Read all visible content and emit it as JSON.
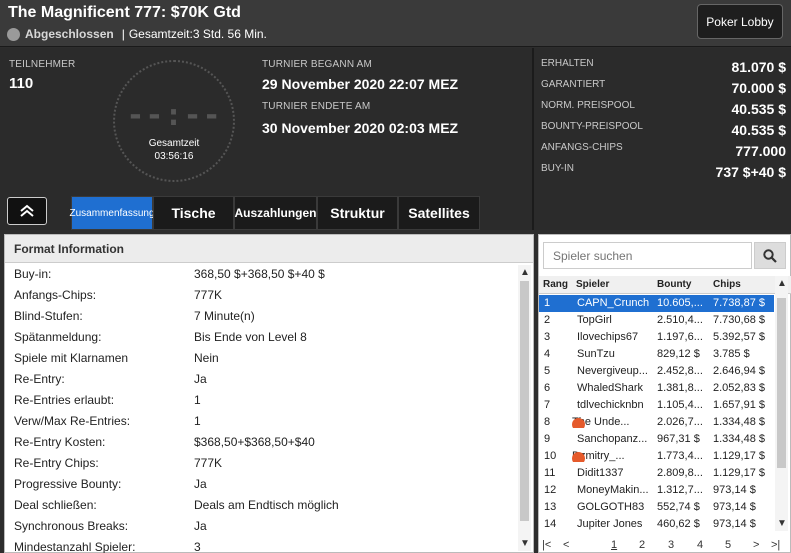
{
  "header": {
    "title": "The Magnificent 777: $70K Gtd",
    "status": "Abgeschlossen",
    "separator": "|",
    "total_time": "Gesamtzeit:3 Std.  56 Min.",
    "lobby_button": "Poker Lobby"
  },
  "info": {
    "participants_label": "TEILNEHMER",
    "participants_value": "110",
    "clock_digits": "--:--",
    "clock_label": "Gesamtzeit",
    "clock_time": "03:56:16",
    "begin_label": "TURNIER BEGANN AM",
    "begin_value": "29 November 2020  22:07 MEZ",
    "end_label": "TURNIER ENDETE AM",
    "end_value": "30 November 2020  02:03 MEZ"
  },
  "prize": [
    {
      "label": "ERHALTEN",
      "value": "81.070 $"
    },
    {
      "label": "GARANTIERT",
      "value": "70.000 $"
    },
    {
      "label": "NORM. PREISPOOL",
      "value": "40.535 $"
    },
    {
      "label": "BOUNTY-PREISPOOL",
      "value": "40.535 $"
    },
    {
      "label": "ANFANGS-CHIPS",
      "value": "777.000"
    },
    {
      "label": "BUY-IN",
      "value": "737 $+40 $"
    }
  ],
  "tabs": [
    {
      "label": "Zusammenfassung",
      "active": true
    },
    {
      "label": "Tische",
      "active": false
    },
    {
      "label": "Auszahlungen",
      "active": false
    },
    {
      "label": "Struktur",
      "active": false
    },
    {
      "label": "Satellites",
      "active": false
    }
  ],
  "format": {
    "title": "Format Information",
    "rows": [
      {
        "label": "Buy-in:",
        "value": "368,50 $+368,50 $+40 $"
      },
      {
        "label": "Anfangs-Chips:",
        "value": "777K"
      },
      {
        "label": "Blind-Stufen:",
        "value": "7 Minute(n)"
      },
      {
        "label": "Spätanmeldung:",
        "value": "Bis Ende von Level 8"
      },
      {
        "label": "Spiele mit Klarnamen",
        "value": "Nein"
      },
      {
        "label": "Re-Entry:",
        "value": "Ja"
      },
      {
        "label": "Re-Entries erlaubt:",
        "value": "1"
      },
      {
        "label": "Verw/Max Re-Entries:",
        "value": "1"
      },
      {
        "label": "Re-Entry Kosten:",
        "value": "$368,50+$368,50+$40"
      },
      {
        "label": "Re-Entry Chips:",
        "value": "777K"
      },
      {
        "label": "Progressive Bounty:",
        "value": "Ja"
      },
      {
        "label": "Deal schließen:",
        "value": "Deals am Endtisch möglich"
      },
      {
        "label": "Synchronous Breaks:",
        "value": "Ja"
      },
      {
        "label": "Mindestanzahl Spieler:",
        "value": "3"
      }
    ]
  },
  "players": {
    "search_placeholder": "Spieler suchen",
    "columns": [
      "Rang",
      "Spieler",
      "Bounty",
      "Chips"
    ],
    "rows": [
      {
        "rank": "1",
        "name": "CAPN_Crunch",
        "bounty": "10.605,...",
        "chips": "7.738,87 $",
        "icon": false
      },
      {
        "rank": "2",
        "name": "TopGirl",
        "bounty": "2.510,4...",
        "chips": "7.730,68 $",
        "icon": false
      },
      {
        "rank": "3",
        "name": "Ilovechips67",
        "bounty": "1.197,6...",
        "chips": "5.392,57 $",
        "icon": false
      },
      {
        "rank": "4",
        "name": "SunTzu",
        "bounty": "829,12 $",
        "chips": "3.785 $",
        "icon": false
      },
      {
        "rank": "5",
        "name": "Nevergiveup...",
        "bounty": "2.452,8...",
        "chips": "2.646,94 $",
        "icon": false
      },
      {
        "rank": "6",
        "name": "WhaledShark",
        "bounty": "1.381,8...",
        "chips": "2.052,83 $",
        "icon": false
      },
      {
        "rank": "7",
        "name": "tdlvechicknbn",
        "bounty": "1.105,4...",
        "chips": "1.657,91 $",
        "icon": false
      },
      {
        "rank": "8",
        "name": "The Unde...",
        "bounty": "2.026,7...",
        "chips": "1.334,48 $",
        "icon": true
      },
      {
        "rank": "9",
        "name": "Sanchopanz...",
        "bounty": "967,31 $",
        "chips": "1.334,48 $",
        "icon": false
      },
      {
        "rank": "10",
        "name": "Dzmitry_...",
        "bounty": "1.773,4...",
        "chips": "1.129,17 $",
        "icon": true
      },
      {
        "rank": "11",
        "name": "Didit1337",
        "bounty": "2.809,8...",
        "chips": "1.129,17 $",
        "icon": false
      },
      {
        "rank": "12",
        "name": "MoneyMakin...",
        "bounty": "1.312,7...",
        "chips": "973,14 $",
        "icon": false
      },
      {
        "rank": "13",
        "name": "GOLGOTH83",
        "bounty": "552,74 $",
        "chips": "973,14 $",
        "icon": false
      },
      {
        "rank": "14",
        "name": "Jupiter Jones",
        "bounty": "460,62 $",
        "chips": "973,14 $",
        "icon": false
      }
    ],
    "pages": [
      "1",
      "2",
      "3",
      "4",
      "5"
    ],
    "selected_rank": "1"
  },
  "colors": {
    "accent": "#1f6fd1",
    "bounty_icon": "#e55a2b"
  }
}
